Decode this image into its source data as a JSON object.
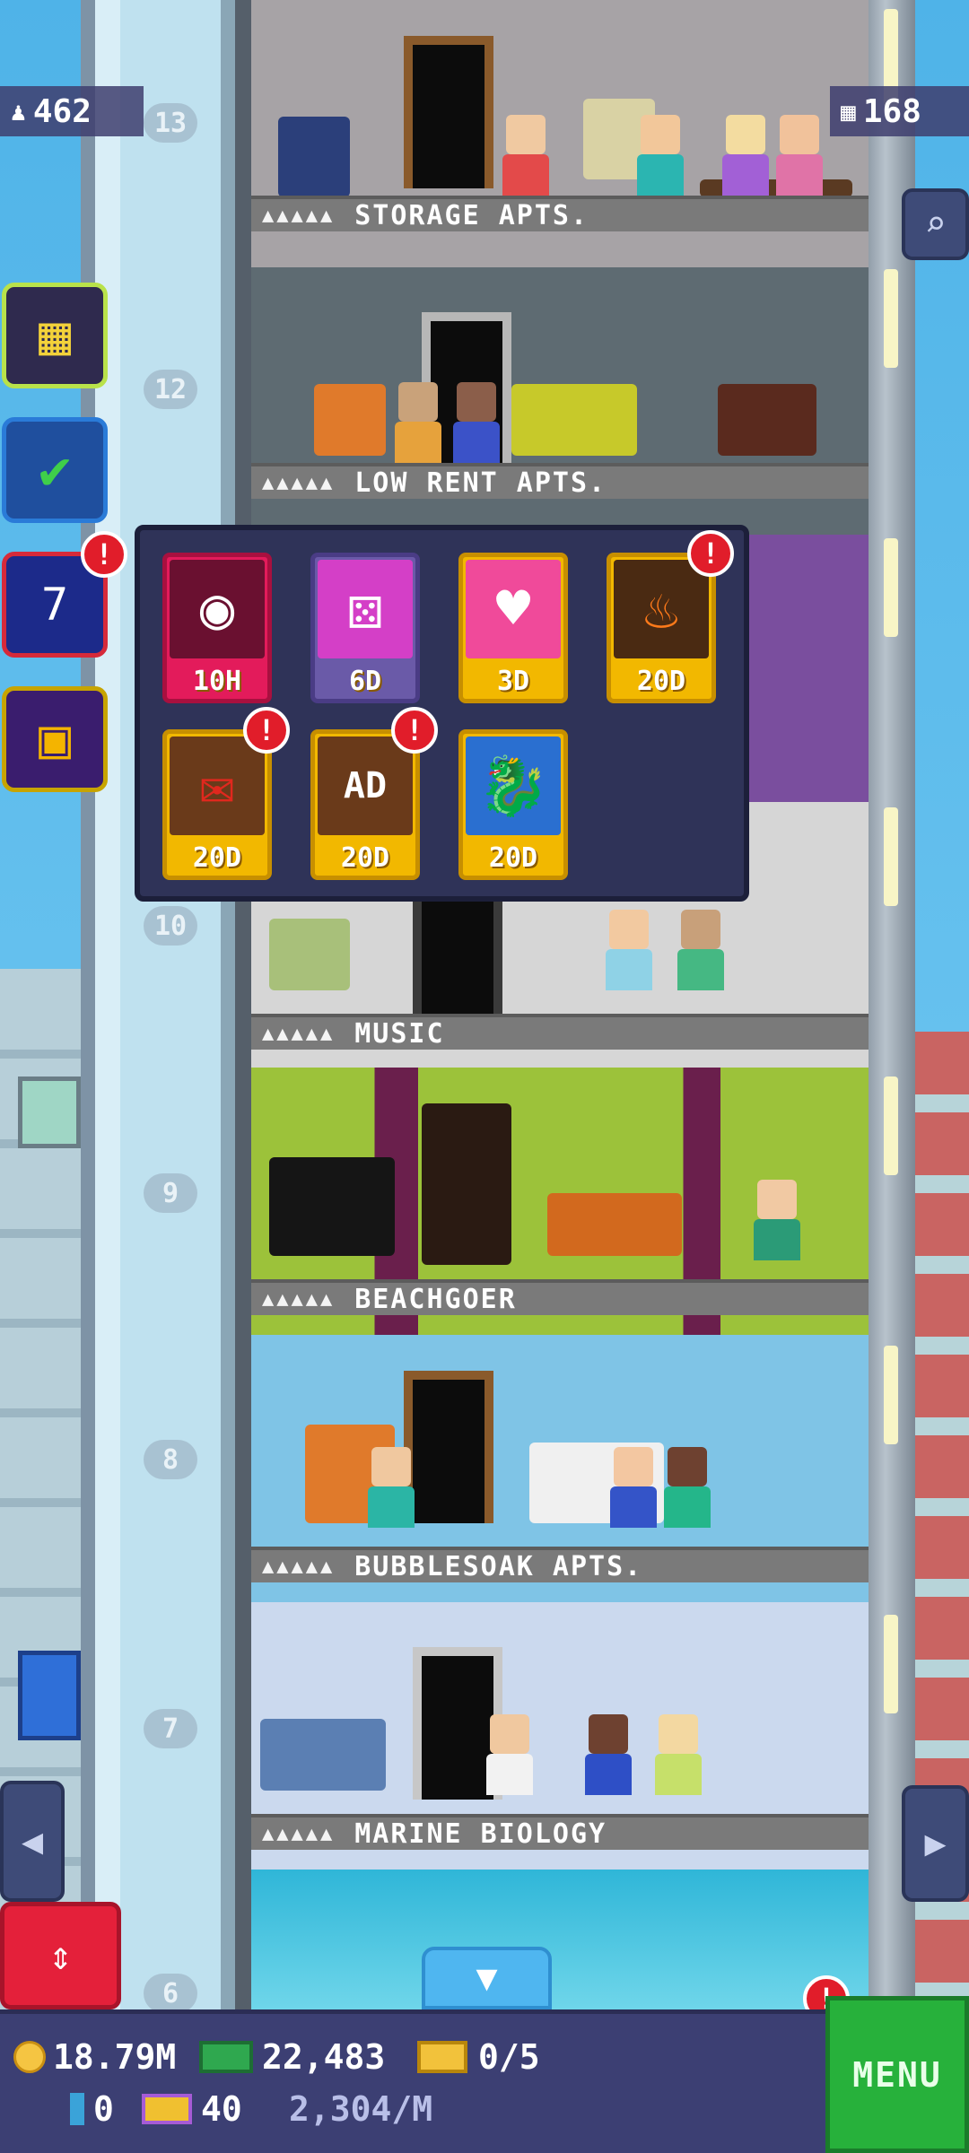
{
  "counters": {
    "population": "462",
    "floors": "168"
  },
  "floors": [
    {
      "number": "13",
      "name": "STORAGE APTS.",
      "stars": "▲▲▲▲▲"
    },
    {
      "number": "12",
      "name": "LOW RENT APTS.",
      "stars": "▲▲▲▲▲"
    },
    {
      "number": "10",
      "name": "MUSIC",
      "stars": "▲▲▲▲▲"
    },
    {
      "number": "9",
      "name": "BEACHGOER",
      "stars": "▲▲▲▲▲"
    },
    {
      "number": "8",
      "name": "BUBBLESOAK APTS.",
      "stars": "▲▲▲▲▲"
    },
    {
      "number": "7",
      "name": "MARINE BIOLOGY",
      "stars": "▲▲▲▲▲"
    }
  ],
  "shaft_numbers": [
    "13",
    "12",
    "10",
    "9",
    "8",
    "7",
    "6"
  ],
  "events": [
    {
      "time": "10H",
      "icon": "prize-wheel-icon",
      "alert": false
    },
    {
      "time": "6D",
      "icon": "dice-icon",
      "alert": false
    },
    {
      "time": "3D",
      "icon": "heart-icon",
      "alert": false
    },
    {
      "time": "20D",
      "icon": "fire-lantern-icon",
      "alert": true
    },
    {
      "time": "20D",
      "icon": "festival-envelopes-icon",
      "alert": true
    },
    {
      "time": "20D",
      "icon": "festival-ad-icon",
      "ad_label": "AD",
      "alert": true
    },
    {
      "time": "20D",
      "icon": "dragon-icon",
      "alert": false
    }
  ],
  "stats": {
    "coins": "18.79M",
    "bux": "22,483",
    "tickets": "0/5",
    "blue_bux": "0",
    "tower_bux": "40",
    "rate": "2,304/M"
  },
  "menu_label": "MENU",
  "alert_mark": "!"
}
